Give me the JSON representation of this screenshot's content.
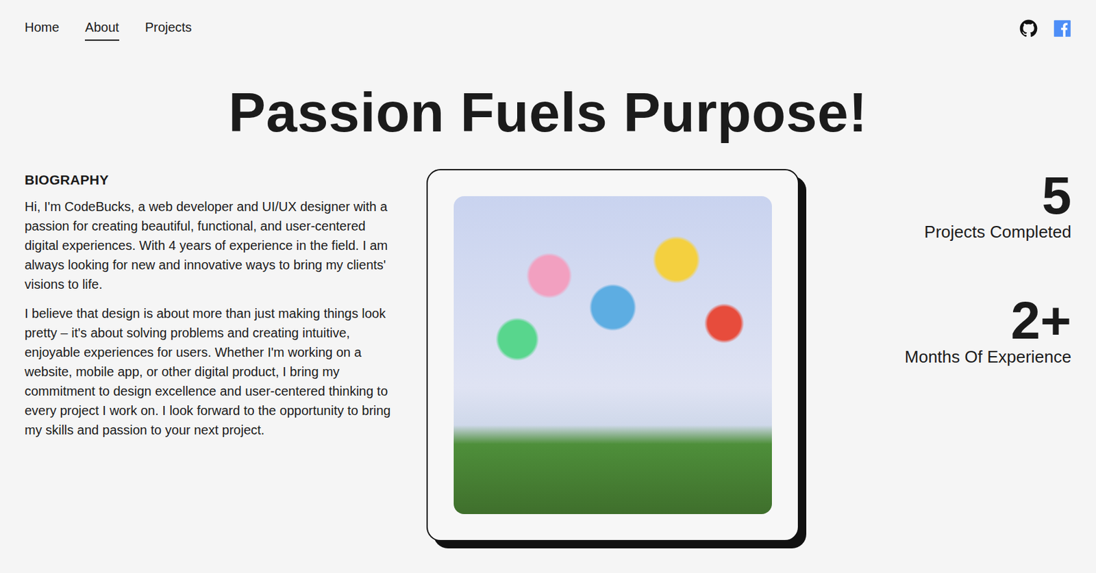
{
  "nav": {
    "links": [
      {
        "label": "Home",
        "selected": false
      },
      {
        "label": "About",
        "selected": true
      },
      {
        "label": "Projects",
        "selected": false
      }
    ]
  },
  "title": "Passion Fuels Purpose!",
  "biography": {
    "heading": "BIOGRAPHY",
    "paragraphs": [
      "Hi, I'm CodeBucks, a web developer and UI/UX designer with a passion for creating beautiful, functional, and user-centered digital experiences. With 4 years of experience in the field. I am always looking for new and innovative ways to bring my clients' visions to life.",
      "I believe that design is about more than just making things look pretty – it's about solving problems and creating intuitive, enjoyable experiences for users. Whether I'm working on a website, mobile app, or other digital product, I bring my commitment to design excellence and user-centered thinking to every project I work on. I look forward to the opportunity to bring my skills and passion to your next project."
    ]
  },
  "stats": [
    {
      "value": "5",
      "label": "Projects Completed"
    },
    {
      "value": "2+",
      "label": "Months Of Experience"
    }
  ]
}
